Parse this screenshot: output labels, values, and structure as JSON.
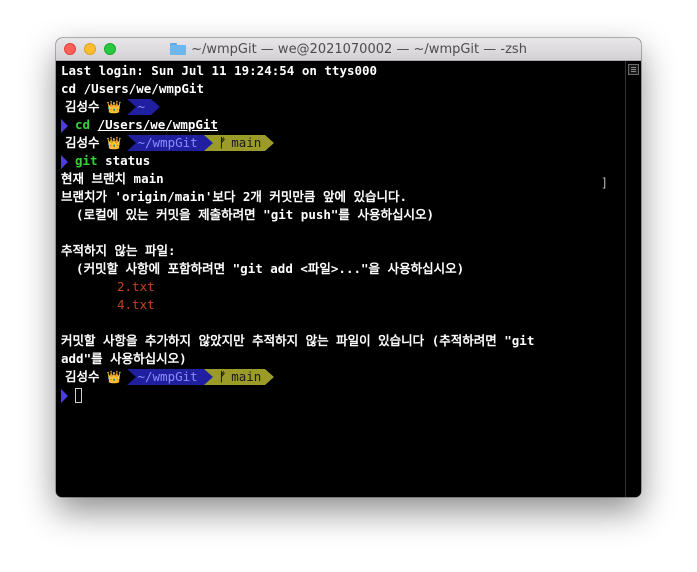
{
  "window": {
    "title": "~/wmpGit — we@2021070002 — ~/wmpGit — -zsh"
  },
  "prompt": {
    "user": "김성수",
    "crown": "👑",
    "branch_glyph": "ᚠ"
  },
  "terminal": {
    "last_login": "Last login: Sun Jul 11 19:24:54 on ttys000",
    "cmd_cd": "cd /Users/we/wmpGit",
    "cmd1_prefix": "cd ",
    "cmd1_path": "/Users/we/wmpGit",
    "prompt1_path": "~",
    "prompt2_path": "~/wmpGit",
    "prompt2_branch": "main",
    "cmd2_word": "git",
    "cmd2_rest": " status",
    "status_branch": "현재 브랜치 main",
    "status_ahead": "브랜치가 'origin/main'보다 2개 커밋만큼 앞에 있습니다.",
    "status_push_hint": "  (로컬에 있는 커밋을 제출하려면 \"git push\"를 사용하십시오)",
    "untracked_header": "추적하지 않는 파일:",
    "untracked_hint": "  (커밋할 사항에 포함하려면 \"git add <파일>...\"을 사용하십시오)",
    "untracked_files": [
      "2.txt",
      "4.txt"
    ],
    "summary_line1": "커밋할 사항을 추가하지 않았지만 추적하지 않는 파일이 있습니다 (추적하려면 \"git",
    "summary_line2": "add\"를 사용하십시오)",
    "prompt3_path": "~/wmpGit",
    "prompt3_branch": "main"
  },
  "colors": {
    "prompt_blue": "#1f1fa0",
    "prompt_olive": "#9b9b2a",
    "untracked_red": "#c9401e",
    "command_green": "#39d13a"
  }
}
